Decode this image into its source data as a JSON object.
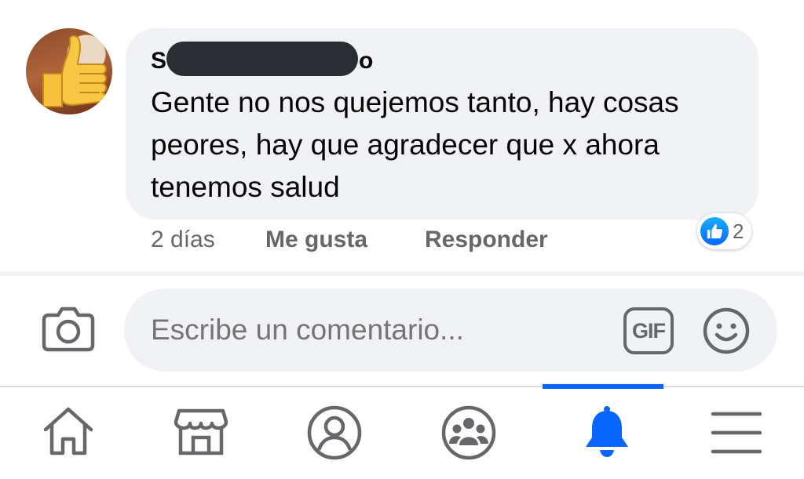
{
  "comment": {
    "author_start": "S",
    "author_end": "o",
    "text": "Gente no nos quejemos tanto, hay cosas peores, hay que agradecer que x ahora tenemos salud",
    "time": "2 días",
    "like_label": "Me gusta",
    "reply_label": "Responder",
    "reaction_count": "2",
    "reaction_icon": "like-icon"
  },
  "composer": {
    "placeholder": "Escribe un comentario...",
    "gif_label": "GIF",
    "camera_icon": "camera-icon",
    "emoji_icon": "emoji-icon"
  },
  "tabbar": {
    "active": "notifications",
    "items": [
      {
        "id": "home",
        "icon": "home-icon"
      },
      {
        "id": "marketplace",
        "icon": "marketplace-icon"
      },
      {
        "id": "profile",
        "icon": "profile-icon"
      },
      {
        "id": "groups",
        "icon": "groups-icon"
      },
      {
        "id": "notifications",
        "icon": "bell-icon"
      },
      {
        "id": "menu",
        "icon": "menu-icon"
      }
    ]
  },
  "colors": {
    "accent": "#0866ff",
    "bubble": "#f0f2f5",
    "secondary_text": "#65676b"
  }
}
